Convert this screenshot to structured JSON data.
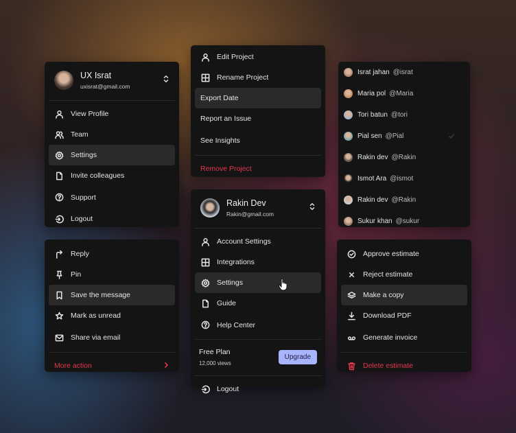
{
  "profile_menu_1": {
    "name": "UX Israt",
    "email": "uxisrat@gmail.com",
    "items": [
      {
        "label": "View Profile",
        "icon": "user-icon"
      },
      {
        "label": "Team",
        "icon": "users-icon"
      },
      {
        "label": "Settings",
        "icon": "gear-icon",
        "active": true
      },
      {
        "label": "Invite colleagues",
        "icon": "file-icon"
      },
      {
        "label": "Support",
        "icon": "help-icon"
      },
      {
        "label": "Logout",
        "icon": "logout-icon"
      }
    ]
  },
  "message_menu": {
    "items": [
      {
        "label": "Reply",
        "icon": "reply-icon"
      },
      {
        "label": "Pin",
        "icon": "pin-icon"
      },
      {
        "label": "Save the message",
        "icon": "bookmark-icon",
        "active": true
      },
      {
        "label": "Mark as unread",
        "icon": "star-icon"
      },
      {
        "label": "Share via email",
        "icon": "mail-icon"
      }
    ],
    "more_action": "More action"
  },
  "project_menu": {
    "items": [
      {
        "label": "Edit Project",
        "icon": "user-icon"
      },
      {
        "label": "Rename Project",
        "icon": "grid-icon"
      },
      {
        "label": "Export Date",
        "active": true
      },
      {
        "label": "Report an Issue"
      },
      {
        "label": "See Insights"
      }
    ],
    "remove": "Remove Project"
  },
  "profile_menu_2": {
    "name": "Rakin Dev",
    "email": "Rakin@gmail.com",
    "items": [
      {
        "label": "Account Settings",
        "icon": "user-icon"
      },
      {
        "label": "Integrations",
        "icon": "grid-icon"
      },
      {
        "label": "Settings",
        "icon": "gear-icon",
        "active": true
      },
      {
        "label": "Guide",
        "icon": "file-icon"
      },
      {
        "label": "Help Center",
        "icon": "help-icon"
      }
    ],
    "plan": {
      "name": "Free Plan",
      "views": "12,000 views",
      "upgrade_label": "Upgrade"
    },
    "logout": "Logout"
  },
  "user_list": {
    "users": [
      {
        "name": "Israt jahan",
        "handle": "@israt",
        "color": "#b48a7a"
      },
      {
        "name": "Maria pol",
        "handle": "@Maria",
        "color": "#c59066"
      },
      {
        "name": "Tori batun",
        "handle": "@tori",
        "color": "#9fb3c9"
      },
      {
        "name": "Pial sen",
        "handle": "@Pial",
        "color": "#7aa9a6",
        "selected": true
      },
      {
        "name": "Rakin dev",
        "handle": "@Rakin",
        "color": "#6b5a52"
      },
      {
        "name": "Ismot Ara",
        "handle": "@ismot",
        "color": "#1b1b1b"
      },
      {
        "name": "Rakin dev",
        "handle": "@Rakin",
        "color": "#c7ccd1"
      },
      {
        "name": "Sukur khan",
        "handle": "@sukur",
        "color": "#a08070"
      }
    ]
  },
  "estimate_menu": {
    "items": [
      {
        "label": "Approve estimate",
        "icon": "check-circle-icon"
      },
      {
        "label": "Reject estimate",
        "icon": "close-icon"
      },
      {
        "label": "Make a copy",
        "icon": "layers-icon",
        "active": true
      },
      {
        "label": "Download PDF",
        "icon": "download-icon"
      },
      {
        "label": "Generate invoice",
        "icon": "voicemail-icon"
      }
    ],
    "delete": "Delete estimate"
  },
  "colors": {
    "accent": "#a9b4ff",
    "danger": "#e5384f",
    "menu_bg": "#141414",
    "active_bg": "#2a2a2b"
  }
}
